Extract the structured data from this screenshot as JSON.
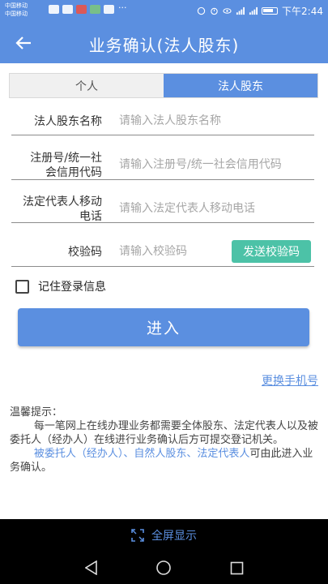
{
  "status_bar": {
    "carrier1": "中国移动",
    "carrier2": "中国移动",
    "app_badges": [
      "淘",
      "微",
      "购",
      "信",
      "Ai"
    ],
    "more": "···",
    "signal_label": "26",
    "time": "下午2:44"
  },
  "app_bar": {
    "back_icon": "arrow-left-icon",
    "title": "业务确认(法人股东)"
  },
  "tabs": [
    {
      "label": "个人",
      "active": false
    },
    {
      "label": "法人股东",
      "active": true
    }
  ],
  "form": {
    "name": {
      "label": "法人股东名称",
      "placeholder": "请输入法人股东名称"
    },
    "reg": {
      "label_line1": "注册号/统一社",
      "label_line2": "会信用代码",
      "placeholder": "请输入注册号/统一社会信用代码"
    },
    "phone": {
      "label_line1": "法定代表人移动",
      "label_line2": "电话",
      "placeholder": "请输入法定代表人移动电话"
    },
    "code": {
      "label": "校验码",
      "placeholder": "请输入校验码",
      "send_button": "发送校验码"
    }
  },
  "remember": {
    "label": "记住登录信息",
    "checked": false
  },
  "enter_button": "进入",
  "change_phone_link": "更换手机号",
  "tips": {
    "title": "温馨提示：",
    "body": "每一笔网上在线办理业务都需要全体股东、法定代表人以及被委托人（经办人）在线进行业务确认后方可提交登记机关。",
    "highlight": "被委托人（经办人）、自然人股东、法定代表人",
    "tail": "可由此进入业务确认。"
  },
  "fullscreen": {
    "label": "全屏显示",
    "icon": "expand-icon"
  },
  "colors": {
    "primary": "#5b8fe0",
    "send_button": "#4cc2a7"
  }
}
